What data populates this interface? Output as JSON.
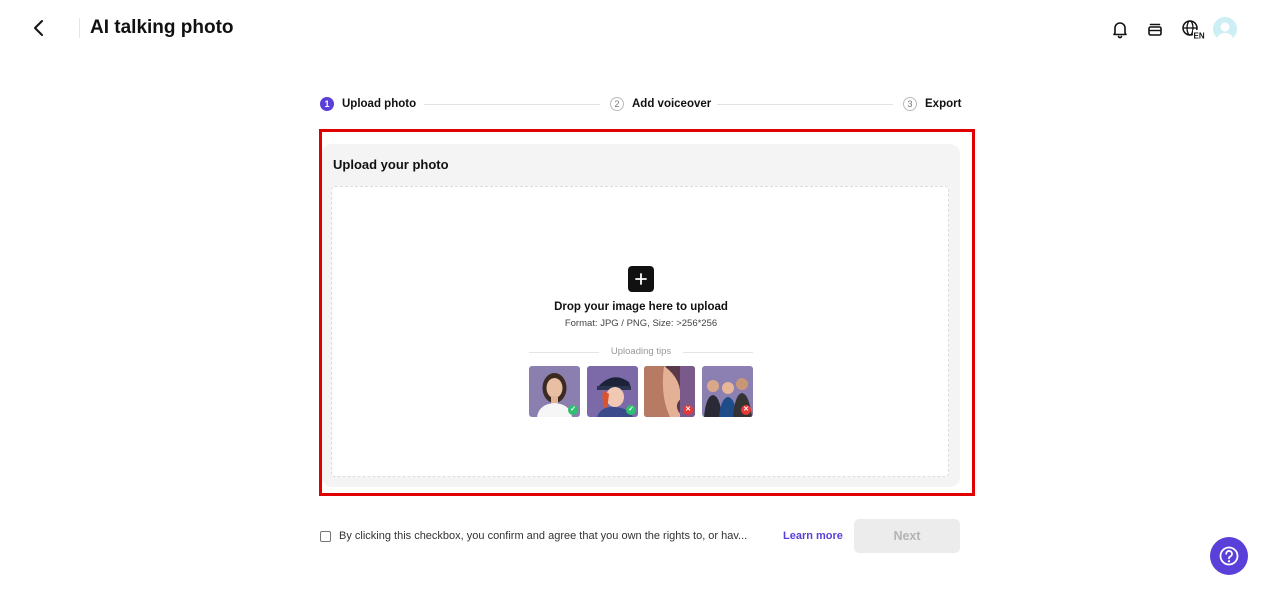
{
  "header": {
    "title": "AI talking photo",
    "icons": [
      "back-arrow-icon",
      "bell-icon",
      "stack-icon",
      "globe-icon",
      "avatar"
    ],
    "language_code": "EN"
  },
  "stepper": {
    "steps": [
      {
        "number": "1",
        "label": "Upload photo",
        "state": "active"
      },
      {
        "number": "2",
        "label": "Add voiceover",
        "state": "inactive"
      },
      {
        "number": "3",
        "label": "Export",
        "state": "inactive"
      }
    ]
  },
  "upload": {
    "heading": "Upload your photo",
    "drop_title": "Drop your image here to upload",
    "format_hint": "Format: JPG / PNG, Size: >256*256",
    "tips_label": "Uploading tips",
    "tip_examples": [
      {
        "name": "good-portrait",
        "status": "ok"
      },
      {
        "name": "good-illustration",
        "status": "ok"
      },
      {
        "name": "bad-profile",
        "status": "bad"
      },
      {
        "name": "bad-group",
        "status": "bad"
      }
    ]
  },
  "footer": {
    "consent_text": "By clicking this checkbox, you confirm and agree that you own the rights to, or hav...",
    "learn_more": "Learn more",
    "next_label": "Next"
  },
  "colors": {
    "accent": "#5b3fd9",
    "highlight": "#e00000",
    "ok": "#2fbf71",
    "bad": "#e53935"
  }
}
